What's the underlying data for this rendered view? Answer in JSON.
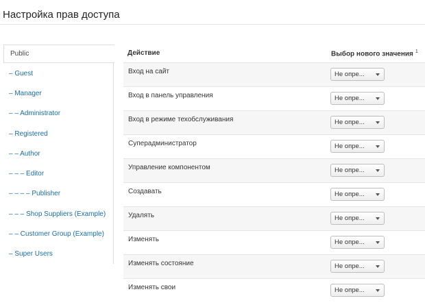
{
  "page": {
    "title": "Настройка прав доступа"
  },
  "sidebar": {
    "items": [
      {
        "label": "Public",
        "active": true
      },
      {
        "label": "– Guest"
      },
      {
        "label": "– Manager"
      },
      {
        "label": "– – Administrator"
      },
      {
        "label": "– Registered"
      },
      {
        "label": "– – Author"
      },
      {
        "label": "– – – Editor"
      },
      {
        "label": "– – – – Publisher"
      },
      {
        "label": "– – – Shop Suppliers (Example)"
      },
      {
        "label": "– – Customer Group (Example)"
      },
      {
        "label": "– Super Users"
      }
    ]
  },
  "table": {
    "header_action": "Действие",
    "header_value": "Выбор нового значения",
    "header_value_note": "1",
    "rows": [
      {
        "action": "Вход на сайт",
        "value": "Не опре..."
      },
      {
        "action": "Вход в панель управления",
        "value": "Не опре..."
      },
      {
        "action": "Вход в режиме техобслуживания",
        "value": "Не опре..."
      },
      {
        "action": "Суперадминистратор",
        "value": "Не опре..."
      },
      {
        "action": "Управление компонентом",
        "value": "Не опре..."
      },
      {
        "action": "Создавать",
        "value": "Не опре..."
      },
      {
        "action": "Удалять",
        "value": "Не опре..."
      },
      {
        "action": "Изменять",
        "value": "Не опре..."
      },
      {
        "action": "Изменять состояние",
        "value": "Не опре..."
      },
      {
        "action": "Изменять свои",
        "value": "Не опре..."
      }
    ]
  },
  "icons": {
    "select_arrow": "caret-down-icon"
  }
}
